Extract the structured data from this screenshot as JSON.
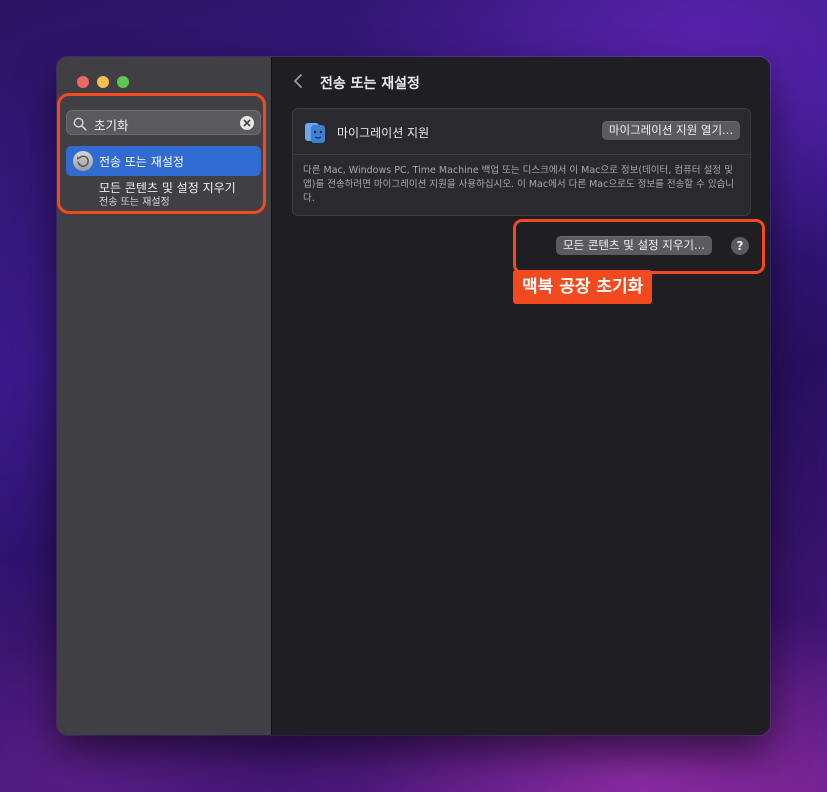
{
  "sidebar": {
    "search": {
      "value": "초기화"
    },
    "results": [
      {
        "label": "전송 또는 재설정",
        "icon": "reset-icon",
        "selected": true
      },
      {
        "label": "모든 콘텐츠 및 설정 지우기",
        "sublabel": "전송 또는 재설정"
      }
    ]
  },
  "main": {
    "title": "전송 또는 재설정",
    "migration": {
      "label": "마이그레이션 지원",
      "button": "마이그레이션 지원 열기...",
      "description": "다른 Mac, Windows PC, Time Machine 백업 또는 디스크에서 이 Mac으로 정보(데이터, 컴퓨터 설정 및 앱)를 전송하려면 마이그레이션 지원을 사용하십시오. 이 Mac에서 다른 Mac으로도 정보를 전송할 수 있습니다."
    },
    "erase_button": "모든 콘텐츠 및 설정 지우기...",
    "help": "?"
  },
  "annotation": {
    "callout": "맥북 공장 초기화",
    "color": "#f24a1e"
  },
  "colors": {
    "selection": "#2f6bd0",
    "accent_highlight": "#f24a1e"
  }
}
